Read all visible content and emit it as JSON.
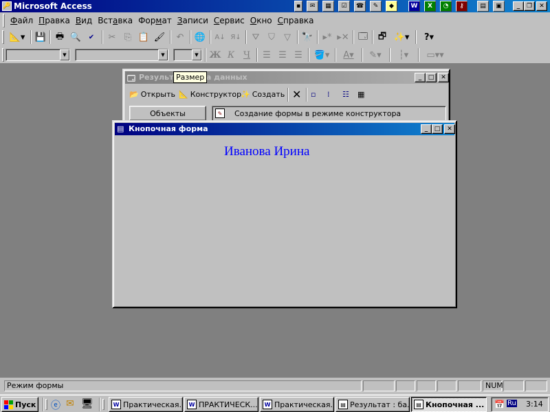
{
  "app": {
    "title": "Microsoft Access"
  },
  "tray_top": {
    "word_label": "W",
    "excel_label": "X",
    "ru_label": "Ru"
  },
  "menu": {
    "items": [
      {
        "pre": "",
        "u": "Ф",
        "post": "айл"
      },
      {
        "pre": "",
        "u": "П",
        "post": "равка"
      },
      {
        "pre": "",
        "u": "В",
        "post": "ид"
      },
      {
        "pre": "Вст",
        "u": "а",
        "post": "вка"
      },
      {
        "pre": "Фор",
        "u": "м",
        "post": "ат"
      },
      {
        "pre": "",
        "u": "З",
        "post": "аписи"
      },
      {
        "pre": "",
        "u": "С",
        "post": "ервис"
      },
      {
        "pre": "",
        "u": "О",
        "post": "кно"
      },
      {
        "pre": "",
        "u": "С",
        "post": "правка"
      }
    ]
  },
  "db_window": {
    "title": "Результат : база данных",
    "open_label": "Открыть",
    "design_label": "Конструктор",
    "create_label": "Создать",
    "objects_label": "Объекты",
    "item_label": "Создание формы в режиме конструктора"
  },
  "tooltip": {
    "text": "Размер"
  },
  "form_window": {
    "title": "Кнопочная форма",
    "name_text": "Иванова Ирина"
  },
  "status": {
    "mode": "Режим формы",
    "num": "NUM"
  },
  "taskbar": {
    "start_label": "Пуск",
    "tasks": [
      "Практическая...",
      "ПРАКТИЧЕСК...",
      "Практическая...",
      "Результат : ба...",
      "Кнопочная ..."
    ],
    "lang": "Ru",
    "clock": "3:14"
  },
  "colors": {
    "title_active": "#000080",
    "name_text": "#0000ff",
    "workspace": "#808080"
  }
}
